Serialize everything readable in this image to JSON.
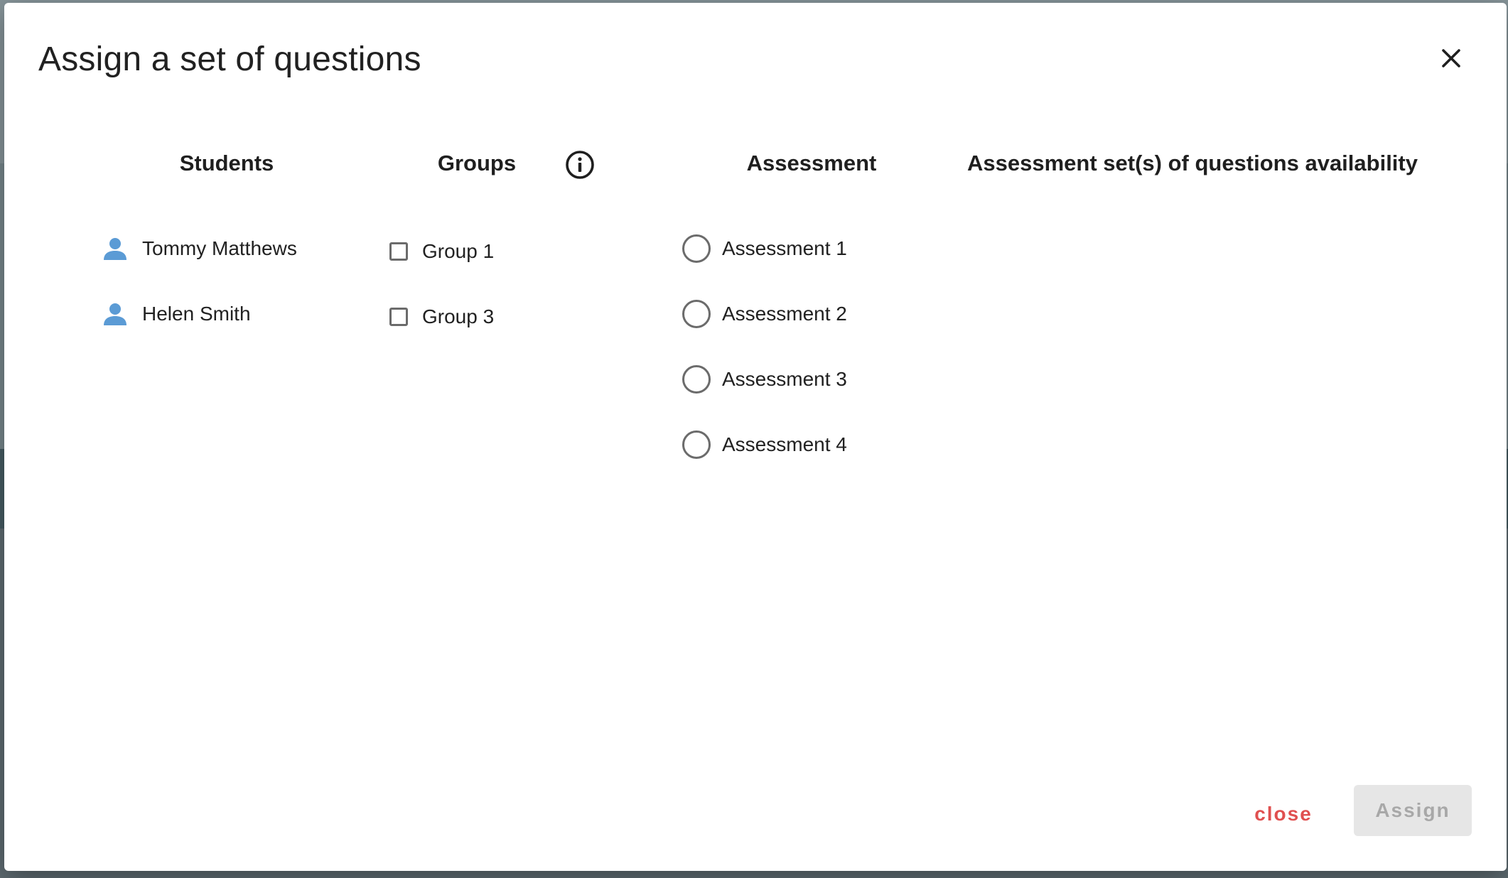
{
  "dialog": {
    "title": "Assign a set of questions"
  },
  "columns": {
    "students": "Students",
    "groups": "Groups",
    "assessment": "Assessment",
    "availability": "Assessment set(s) of questions availability"
  },
  "students": [
    {
      "name": "Tommy Matthews"
    },
    {
      "name": "Helen Smith"
    }
  ],
  "groups": [
    {
      "label": "Group 1",
      "checked": false
    },
    {
      "label": "Group 3",
      "checked": false
    }
  ],
  "assessments": [
    {
      "label": "Assessment 1",
      "selected": false
    },
    {
      "label": "Assessment 2",
      "selected": false
    },
    {
      "label": "Assessment 3",
      "selected": false
    },
    {
      "label": "Assessment 4",
      "selected": false
    }
  ],
  "actions": {
    "close_label": "close",
    "assign_label": "Assign"
  },
  "colors": {
    "close_text": "#e05050",
    "person_icon": "#5b9bd5",
    "assign_disabled_bg": "#e6e6e6",
    "assign_disabled_text": "#a8a8a8"
  },
  "icons": {
    "close": "close-icon",
    "info": "info-icon",
    "person": "person-icon"
  }
}
